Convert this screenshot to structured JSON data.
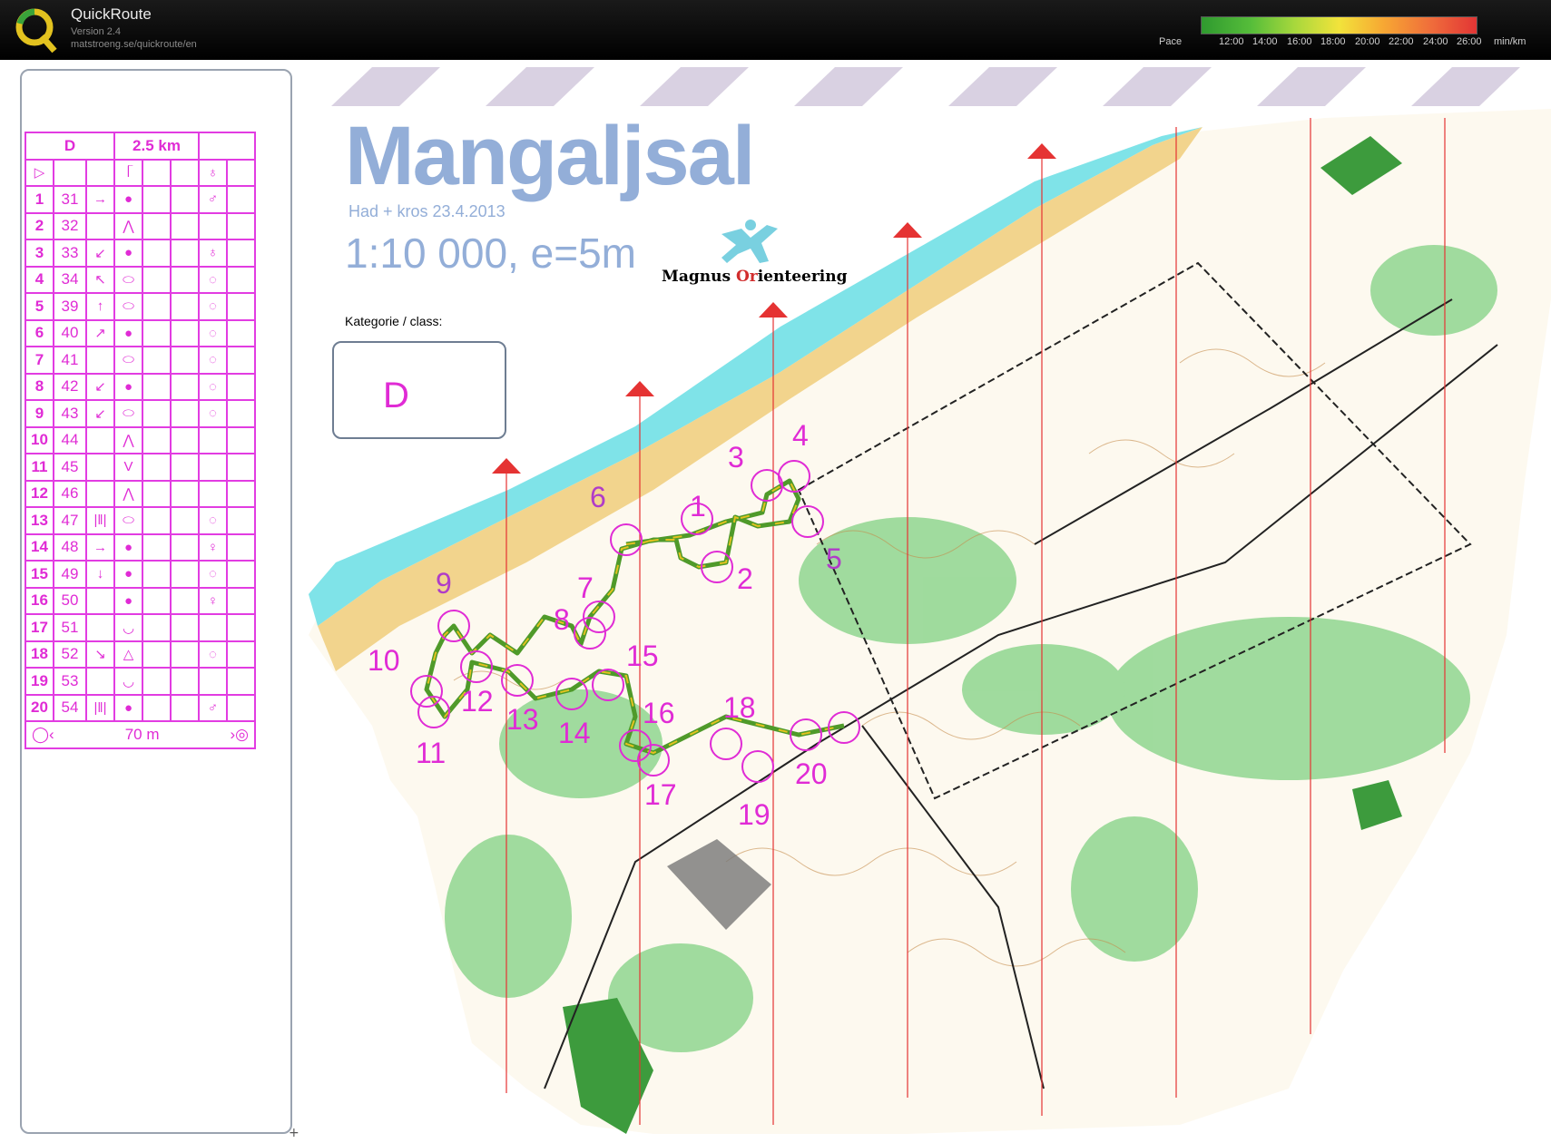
{
  "app": {
    "title": "QuickRoute",
    "version": "Version 2.4",
    "url": "matstroeng.se/quickroute/en",
    "pace_label": "Pace",
    "pace_ticks": [
      "12:00",
      "14:00",
      "16:00",
      "18:00",
      "20:00",
      "22:00",
      "24:00",
      "26:00"
    ],
    "pace_unit": "min/km"
  },
  "map": {
    "title": "Mangaljsal",
    "subtitle": "Had + kros 23.4.2013",
    "scale": "1:10 000, e=5m",
    "club": {
      "part1": "Magnus ",
      "part2": "Or",
      "part3": "ienteering"
    },
    "class_label": "Kategorie / class:",
    "class_value": "D"
  },
  "description_sheet": {
    "class": "D",
    "length": "2.5 km",
    "controls": [
      {
        "n": "1",
        "code": "31",
        "dir": "→",
        "feature": "●",
        "extra": "♂"
      },
      {
        "n": "2",
        "code": "32",
        "dir": "",
        "feature": "⋀",
        "extra": ""
      },
      {
        "n": "3",
        "code": "33",
        "dir": "↙",
        "feature": "●",
        "extra": "♁"
      },
      {
        "n": "4",
        "code": "34",
        "dir": "↖",
        "feature": "⬭",
        "extra": "◌"
      },
      {
        "n": "5",
        "code": "39",
        "dir": "↑",
        "feature": "⬭",
        "extra": "◌"
      },
      {
        "n": "6",
        "code": "40",
        "dir": "↗",
        "feature": "●",
        "extra": "◌"
      },
      {
        "n": "7",
        "code": "41",
        "dir": "",
        "feature": "⬭",
        "extra": "◌"
      },
      {
        "n": "8",
        "code": "42",
        "dir": "↙",
        "feature": "●",
        "extra": "◌"
      },
      {
        "n": "9",
        "code": "43",
        "dir": "↙",
        "feature": "⬭",
        "extra": "◌"
      },
      {
        "n": "10",
        "code": "44",
        "dir": "",
        "feature": "⋀",
        "extra": ""
      },
      {
        "n": "11",
        "code": "45",
        "dir": "",
        "feature": "V",
        "extra": ""
      },
      {
        "n": "12",
        "code": "46",
        "dir": "",
        "feature": "⋀",
        "extra": ""
      },
      {
        "n": "13",
        "code": "47",
        "dir": "|‖|",
        "feature": "⬭",
        "extra": "◌"
      },
      {
        "n": "14",
        "code": "48",
        "dir": "→",
        "feature": "●",
        "extra": "♀"
      },
      {
        "n": "15",
        "code": "49",
        "dir": "↓",
        "feature": "●",
        "extra": "◌"
      },
      {
        "n": "16",
        "code": "50",
        "dir": "",
        "feature": "●",
        "extra": "♀"
      },
      {
        "n": "17",
        "code": "51",
        "dir": "",
        "feature": "◡",
        "extra": ""
      },
      {
        "n": "18",
        "code": "52",
        "dir": "↘",
        "feature": "△",
        "extra": "◌"
      },
      {
        "n": "19",
        "code": "53",
        "dir": "",
        "feature": "◡",
        "extra": ""
      },
      {
        "n": "20",
        "code": "54",
        "dir": "|‖|",
        "feature": "●",
        "extra": "♂"
      }
    ],
    "finish_distance": "70 m"
  },
  "control_labels": [
    "1",
    "2",
    "3",
    "4",
    "5",
    "6",
    "7",
    "8",
    "9",
    "10",
    "11",
    "12",
    "13",
    "14",
    "15",
    "16",
    "17",
    "18",
    "19",
    "20"
  ],
  "colors": {
    "course": "#e02bd5",
    "route": "#4f9a2a",
    "water": "#7fe3e8",
    "title": "#93aed8"
  }
}
